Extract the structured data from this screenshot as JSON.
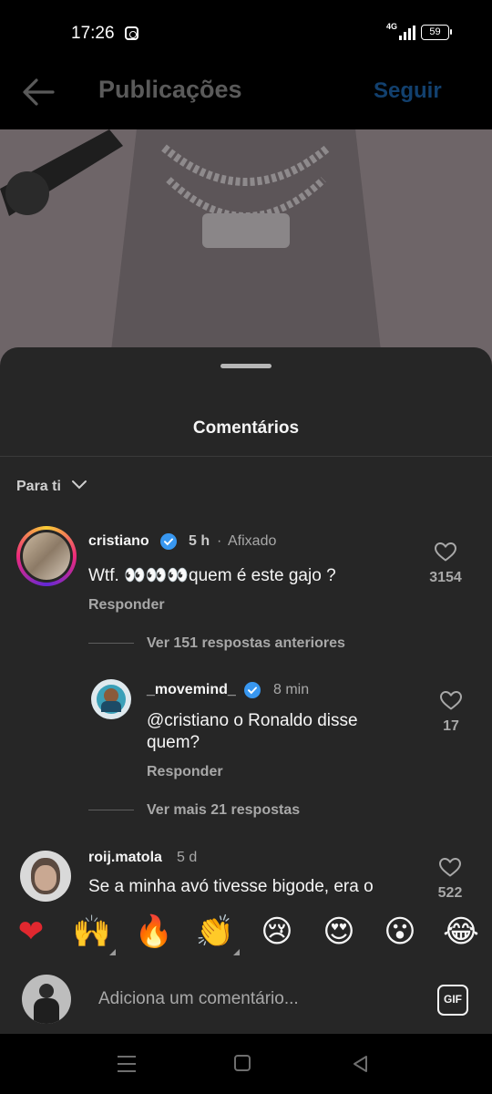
{
  "status_bar": {
    "time": "17:26",
    "network": "4G",
    "battery": "59",
    "icons": [
      "instagram-icon",
      "signal-icon",
      "battery-icon"
    ]
  },
  "header": {
    "title": "Publicações",
    "follow_label": "Seguir",
    "follow_color": "#12406e"
  },
  "sheet": {
    "title": "Comentários",
    "sort_label": "Para ti"
  },
  "comments": [
    {
      "username": "cristiano",
      "verified": true,
      "time": "5 h",
      "pinned_label": "Afixado",
      "text": "Wtf. 👀👀👀quem é este gajo ?",
      "reply_label": "Responder",
      "likes": "3154"
    },
    {
      "username": "_movemind_",
      "verified": true,
      "time": "8 min",
      "text_line1": "@cristiano o Ronaldo disse",
      "text_line2": "quem?",
      "reply_label": "Responder",
      "likes": "17"
    },
    {
      "username": "roij.matola",
      "verified": false,
      "time": "5 d",
      "text": "Se a minha avó tivesse bigode, era o",
      "likes": "522"
    }
  ],
  "threads": {
    "previous_replies": "Ver 151 respostas anteriores",
    "more_replies": "Ver mais 21 respostas"
  },
  "emoji_bar": [
    "❤",
    "🙌",
    "🔥",
    "👏",
    "😢",
    "😍",
    "😮",
    "😂"
  ],
  "composer": {
    "placeholder": "Adiciona um comentário...",
    "gif_label": "GIF"
  },
  "colors": {
    "sheet_bg": "#262626",
    "verified_blue": "#3897f0",
    "muted_text": "#a8a8a8"
  }
}
